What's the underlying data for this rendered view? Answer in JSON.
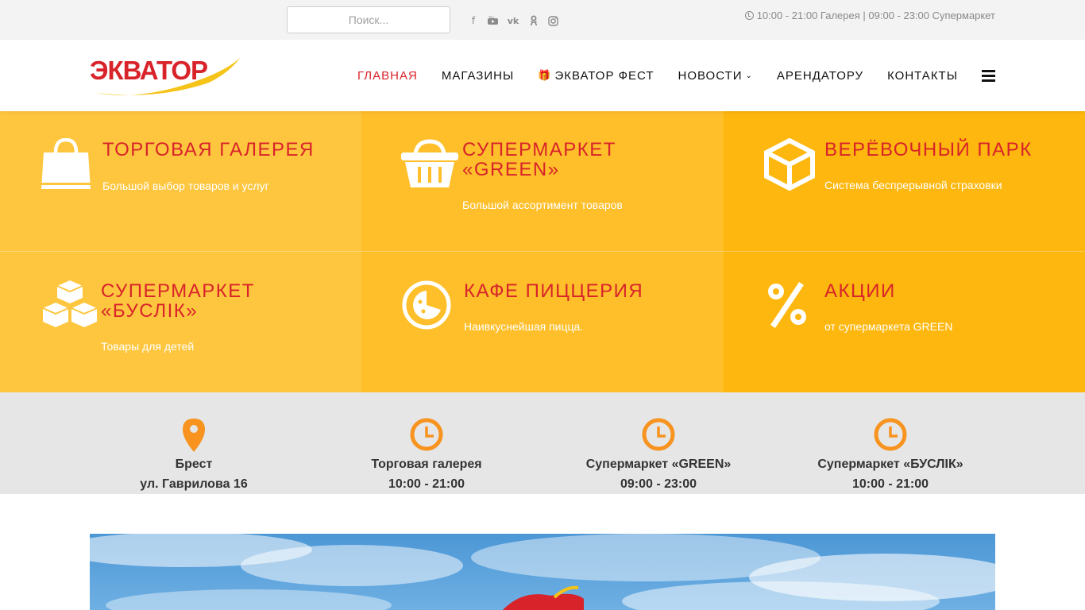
{
  "topbar": {
    "search_placeholder": "Поиск...",
    "socials": [
      "facebook-icon",
      "youtube-icon",
      "vk-icon",
      "odnoklassniki-icon",
      "instagram-icon"
    ],
    "hours": "10:00 - 21:00 Галерея | 09:00 - 23:00 Супермаркет"
  },
  "header": {
    "logo_text": "ЭКВАТОР",
    "nav": {
      "home": "ГЛАВНАЯ",
      "shops": "МАГАЗИНЫ",
      "fest": "ЭКВАТОР ФЕСТ",
      "news": "НОВОСТИ",
      "tenant": "АРЕНДАТОРУ",
      "contacts": "КОНТАКТЫ"
    }
  },
  "tiles": [
    {
      "title": "ТОРГОВАЯ ГАЛЕРЕЯ",
      "text": "Большой выбор товаров и услуг",
      "icon": "shopping-bag-icon"
    },
    {
      "title": "СУПЕРМАРКЕТ «GREEN»",
      "text": "Большой ассортимент товаров",
      "icon": "basket-icon"
    },
    {
      "title": "ВЕРЁВОЧНЫЙ ПАРК",
      "text": "Система беспрерывной страховки",
      "icon": "cube-outline-icon"
    },
    {
      "title": "СУПЕРМАРКЕТ «БУСЛІК»",
      "text": "Товары для детей",
      "icon": "toy-blocks-icon"
    },
    {
      "title": "КАФЕ ПИЦЦЕРИЯ",
      "text": "Наивкуснейшая пицца.",
      "icon": "pizza-icon"
    },
    {
      "title": "АКЦИИ",
      "text": "от супермаркета GREEN",
      "icon": "percent-icon"
    }
  ],
  "info": [
    {
      "line1": "Брест",
      "line2": "ул. Гаврилова 16",
      "icon": "map-pin-icon"
    },
    {
      "line1": "Торговая галерея",
      "line2": "10:00 - 21:00",
      "icon": "clock-icon"
    },
    {
      "line1": "Супермаркет «GREEN»",
      "line2": "09:00 - 23:00",
      "icon": "clock-icon"
    },
    {
      "line1": "Супермаркет «БУСЛІК»",
      "line2": "10:00 - 21:00",
      "icon": "clock-icon"
    }
  ],
  "colors": {
    "accent_red": "#d8232a",
    "tile_light": "#fec63e",
    "tile_mid": "#febf2a",
    "tile_dark": "#fdb70e",
    "icon_orange": "#f7931e"
  }
}
